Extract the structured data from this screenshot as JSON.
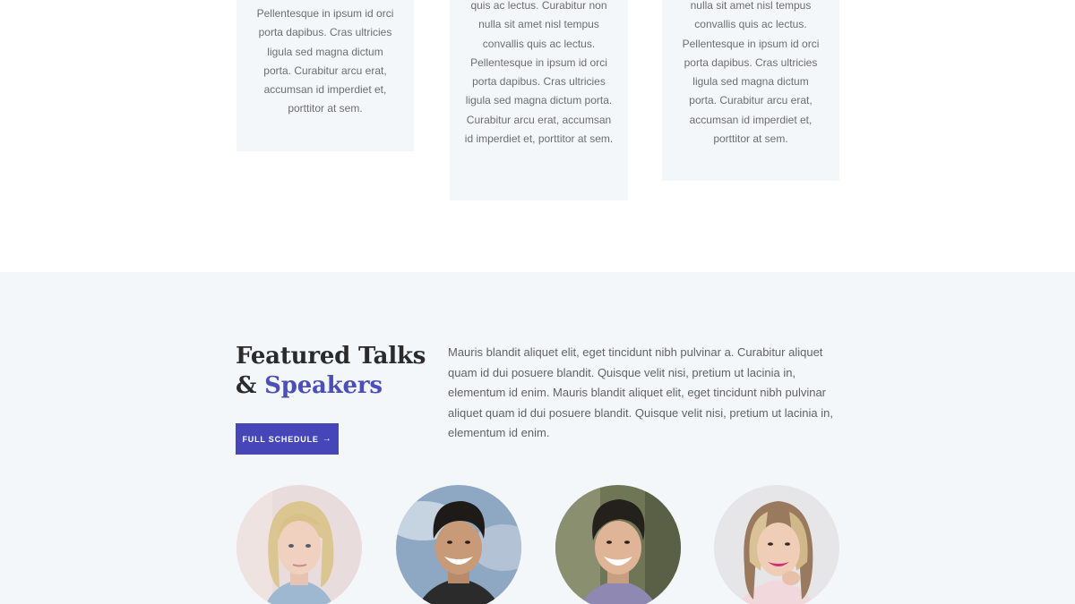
{
  "cards": [
    {
      "text": "Pellentesque in ipsum id orci porta dapibus. Cras ultricies ligula sed magna dictum porta. Curabitur arcu erat, accumsan id imperdiet et, porttitor at sem."
    },
    {
      "text": "quis ac lectus. Curabitur non nulla sit amet nisl tempus convallis quis ac lectus. Pellentesque in ipsum id orci porta dapibus. Cras ultricies ligula sed magna dictum porta. Curabitur arcu erat, accumsan id imperdiet et, porttitor at sem."
    },
    {
      "text": "nulla sit amet nisl tempus convallis quis ac lectus. Pellentesque in ipsum id orci porta dapibus. Cras ultricies ligula sed magna dictum porta. Curabitur arcu erat, accumsan id imperdiet et, porttitor at sem."
    }
  ],
  "featured": {
    "heading_line1": "Featured Talks",
    "heading_amp": "& ",
    "heading_accent": "Speakers",
    "button_label": "FULL SCHEDULE",
    "button_arrow": "→",
    "intro": "Mauris blandit aliquet elit, eget tincidunt nibh pulvinar a. Curabitur aliquet quam id dui posuere blandit. Quisque velit nisi, pretium ut lacinia in, elementum id enim. Mauris blandit aliquet elit, eget tincidunt nibh pulvinar aliquet quam id dui posuere blandit. Quisque velit nisi, pretium ut lacinia in, elementum id enim."
  },
  "colors": {
    "accent": "#4c4fb8",
    "button": "#4646b8",
    "section_bg": "#f4f7fa"
  },
  "speakers": [
    {
      "icon": "speaker-photo-icon"
    },
    {
      "icon": "speaker-photo-icon"
    },
    {
      "icon": "speaker-photo-icon"
    },
    {
      "icon": "speaker-photo-icon"
    }
  ]
}
